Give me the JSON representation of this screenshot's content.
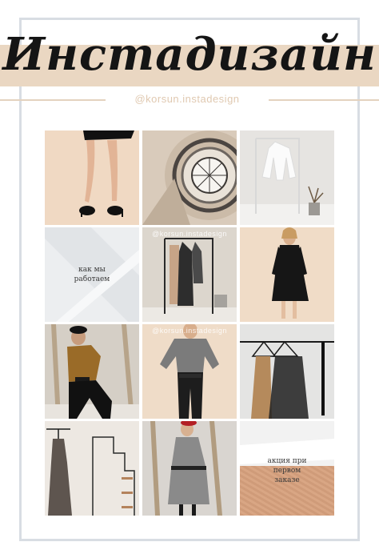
{
  "header": {
    "title": "Инстадизайн",
    "handle": "@korsun.instadesign"
  },
  "colors": {
    "banner": "#ead7c2",
    "frame": "#d8dde3",
    "handle_text": "#e0c9b1"
  },
  "tiles": [
    {
      "subject": "legs-in-heels-photo"
    },
    {
      "subject": "spiral-staircase-photo"
    },
    {
      "subject": "white-blouse-on-rack-photo"
    },
    {
      "subject": "how-we-work-post",
      "caption_line1": "как мы",
      "caption_line2": "работаем"
    },
    {
      "subject": "clothes-on-rack-photo",
      "watermark": "@korsun.instadesign"
    },
    {
      "subject": "black-dress-model-photo"
    },
    {
      "subject": "gold-blouse-model-photo"
    },
    {
      "subject": "grey-sweater-model-photo",
      "watermark": "@korsun.instadesign"
    },
    {
      "subject": "sheer-blouse-hangers-photo"
    },
    {
      "subject": "sheer-dress-on-stairs-photo"
    },
    {
      "subject": "grey-coat-model-photo"
    },
    {
      "subject": "promo-post",
      "caption_line1": "акция при",
      "caption_line2": "первом",
      "caption_line3": "заказе"
    }
  ]
}
